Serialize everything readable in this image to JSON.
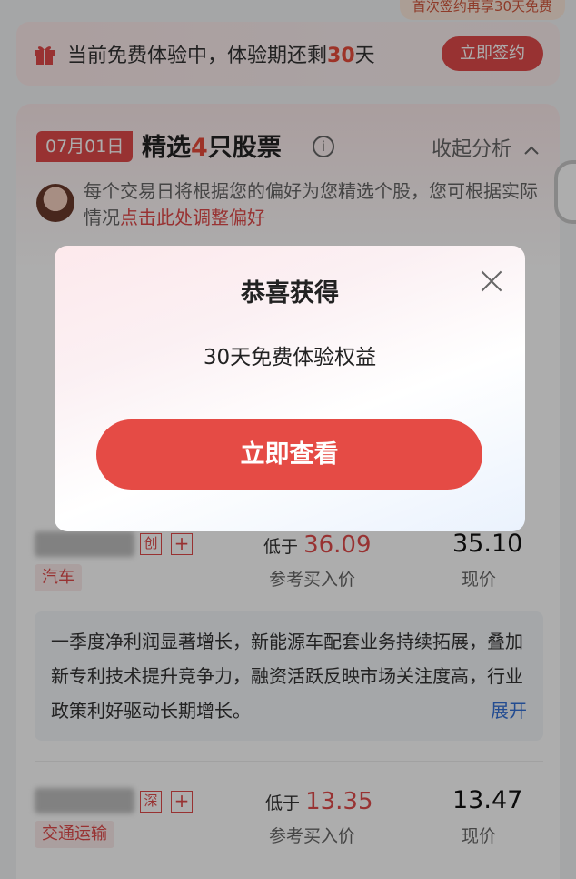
{
  "top_banner": {
    "text": "首次签约再享30天免费"
  },
  "trial": {
    "text_prefix": "当前免费体验中，体验期还剩",
    "days": "30",
    "text_suffix": "天",
    "sign_button": "立即签约"
  },
  "picks": {
    "date": "07月01日",
    "title_prefix": "精选",
    "count": "4",
    "title_suffix": "只股票",
    "collapse_label": "收起分析",
    "pref_text": "每个交易日将根据您的偏好为您精选个股，您可根据实际情况",
    "pref_link": "点击此处调整偏好"
  },
  "stocks": [
    {
      "market_tag": "创",
      "sector": "汽车",
      "buy_prefix": "低于",
      "buy_price": "36.09",
      "buy_label": "参考买入价",
      "current_price": "35.10",
      "current_label": "现价",
      "description": "一季度净利润显著增长，新能源车配套业务持续拓展，叠加新专利技术提升竞争力，融资活跃反映市场关注度高，行业政策利好驱动长期增长。",
      "expand_label": "展开"
    },
    {
      "market_tag": "深",
      "sector": "交通运输",
      "buy_prefix": "低于",
      "buy_price": "13.35",
      "buy_label": "参考买入价",
      "current_price": "13.47",
      "current_label": "现价"
    }
  ],
  "dialog": {
    "title": "恭喜获得",
    "subtitle": "30天免费体验权益",
    "button": "立即查看"
  }
}
